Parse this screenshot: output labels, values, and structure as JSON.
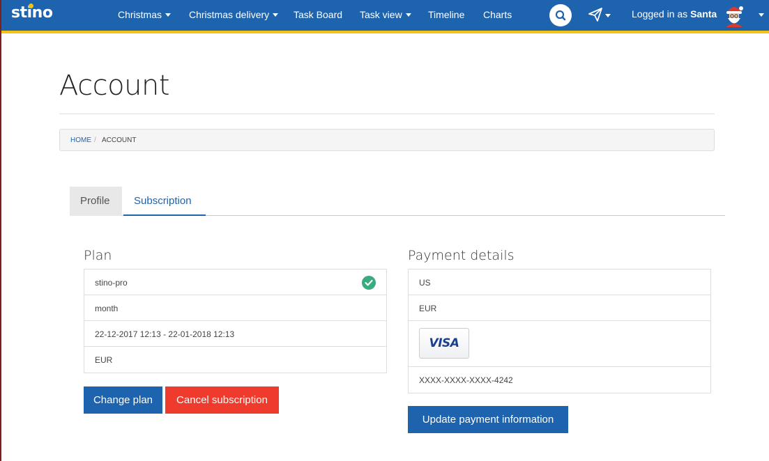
{
  "brand": {
    "name": "stino"
  },
  "nav": {
    "items": [
      {
        "label": "Christmas",
        "dropdown": true
      },
      {
        "label": "Christmas delivery",
        "dropdown": true
      },
      {
        "label": "Task Board",
        "dropdown": false
      },
      {
        "label": "Task view",
        "dropdown": true
      },
      {
        "label": "Timeline",
        "dropdown": false
      },
      {
        "label": "Charts",
        "dropdown": false
      }
    ],
    "logged_in_prefix": "Logged in as",
    "user_name": "Santa"
  },
  "page": {
    "title": "Account"
  },
  "breadcrumb": {
    "home": "HOME",
    "separator": "/",
    "current": "ACCOUNT"
  },
  "tabs": {
    "profile": "Profile",
    "subscription": "Subscription",
    "active": "subscription"
  },
  "plan": {
    "title": "Plan",
    "rows": [
      "stino-pro",
      "month",
      "22-12-2017 12:13 - 22-01-2018 12:13",
      "EUR"
    ],
    "change_label": "Change plan",
    "cancel_label": "Cancel subscription"
  },
  "payment": {
    "title": "Payment details",
    "country": "US",
    "currency": "EUR",
    "card_brand": "VISA",
    "card_number": "XXXX-XXXX-XXXX-4242",
    "update_label": "Update payment information"
  },
  "colors": {
    "primary": "#1e63ad",
    "danger": "#ef3b2d",
    "accent": "#f2c314",
    "success": "#3aaa7f"
  }
}
